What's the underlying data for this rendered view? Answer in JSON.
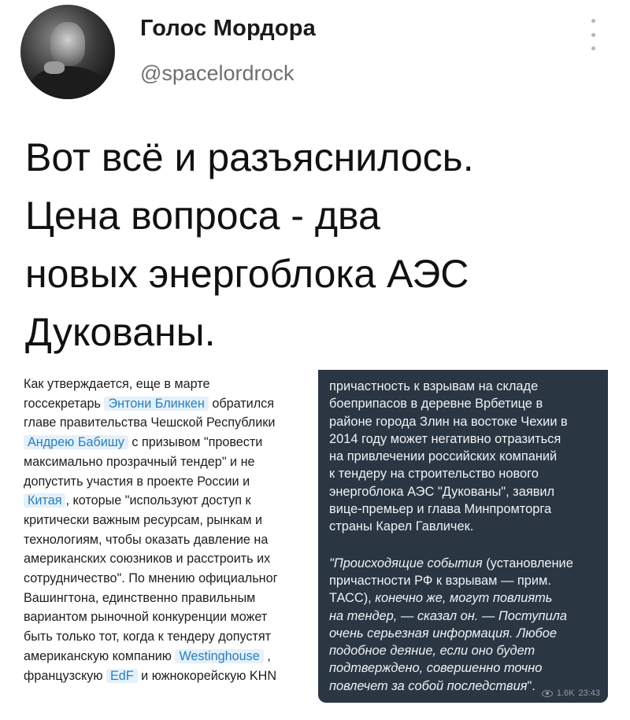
{
  "author": {
    "display_name": "Голос Мордора",
    "handle": "@spacelordrock"
  },
  "tweet": {
    "lines": [
      "Вот всё и разъяснилось.",
      "Цена вопроса - два",
      "новых энергоблока АЭС",
      "Дукованы."
    ]
  },
  "left_doc": {
    "lines": [
      [
        {
          "t": "Как утверждается, еще в марте"
        }
      ],
      [
        {
          "t": "госсекретарь "
        },
        {
          "t": "Энтони Блинкен",
          "hl": true
        },
        {
          "t": " обратился"
        }
      ],
      [
        {
          "t": "главе правительства Чешской Республики"
        }
      ],
      [
        {
          "t": "Андрею Бабишу",
          "hl": true
        },
        {
          "t": " с призывом \"провести"
        }
      ],
      [
        {
          "t": "максимально прозрачный тендер\" и не"
        }
      ],
      [
        {
          "t": "допустить участия в проекте России и"
        }
      ],
      [
        {
          "t": "Китая",
          "hl": true
        },
        {
          "t": ", которые \"используют доступ к"
        }
      ],
      [
        {
          "t": "критически важным ресурсам, рынкам и"
        }
      ],
      [
        {
          "t": "технологиям, чтобы оказать давление на"
        }
      ],
      [
        {
          "t": "американских союзников и расстроить их"
        }
      ],
      [
        {
          "t": "сотрудничество\". По мнению официальног"
        }
      ],
      [
        {
          "t": "Вашингтона, единственно правильным"
        }
      ],
      [
        {
          "t": "вариантом рыночной конкуренции может"
        }
      ],
      [
        {
          "t": "быть только тот, когда к тендеру допустят"
        }
      ],
      [
        {
          "t": "американскую компанию "
        },
        {
          "t": "Westinghouse",
          "hl": true
        },
        {
          "t": " ,"
        }
      ],
      [
        {
          "t": "французскую "
        },
        {
          "t": "EdF",
          "hl": true
        },
        {
          "t": " и южнокорейскую KHN"
        }
      ]
    ]
  },
  "right_doc": {
    "para1": [
      [
        {
          "t": "причастность к взрывам на складе"
        }
      ],
      [
        {
          "t": "боеприпасов в деревне Врбетице в"
        }
      ],
      [
        {
          "t": "районе города Злин на востоке Чехии в"
        }
      ],
      [
        {
          "t": "2014 году может негативно отразиться"
        }
      ],
      [
        {
          "t": "на привлечении российских компаний"
        }
      ],
      [
        {
          "t": "к тендеру на строительство нового"
        }
      ],
      [
        {
          "t": "энергоблока АЭС \"Дукованы\", заявил"
        }
      ],
      [
        {
          "t": "вице-премьер и глава Минпромторга"
        }
      ],
      [
        {
          "t": "страны Карел Гавличек."
        }
      ]
    ],
    "para2": [
      [
        {
          "t": "\"Происходящие события",
          "i": true
        },
        {
          "t": " (установление"
        }
      ],
      [
        {
          "t": "причастности РФ к взрывам — прим."
        }
      ],
      [
        {
          "t": "ТАСС), "
        },
        {
          "t": "конечно же, могут повлиять",
          "i": true
        }
      ],
      [
        {
          "t": "на тендер, — сказал он. — Поступила",
          "i": true
        }
      ],
      [
        {
          "t": "очень серьезная информация. Любое",
          "i": true
        }
      ],
      [
        {
          "t": "подобное деяние, если оно будет",
          "i": true
        }
      ],
      [
        {
          "t": "подтверждено, совершенно точно",
          "i": true
        }
      ],
      [
        {
          "t": "повлечет за собой последствия",
          "i": true
        },
        {
          "t": "\"."
        }
      ]
    ],
    "views": "1.6K",
    "time": "23:43"
  },
  "icons": {
    "more": "more-vertical-icon",
    "views": "eye-icon"
  },
  "colors": {
    "highlight_bg": "#e4f1fa",
    "highlight_text": "#2b7fb8",
    "dark_panel": "#2a3642",
    "handle_gray": "#6f6f6f"
  }
}
